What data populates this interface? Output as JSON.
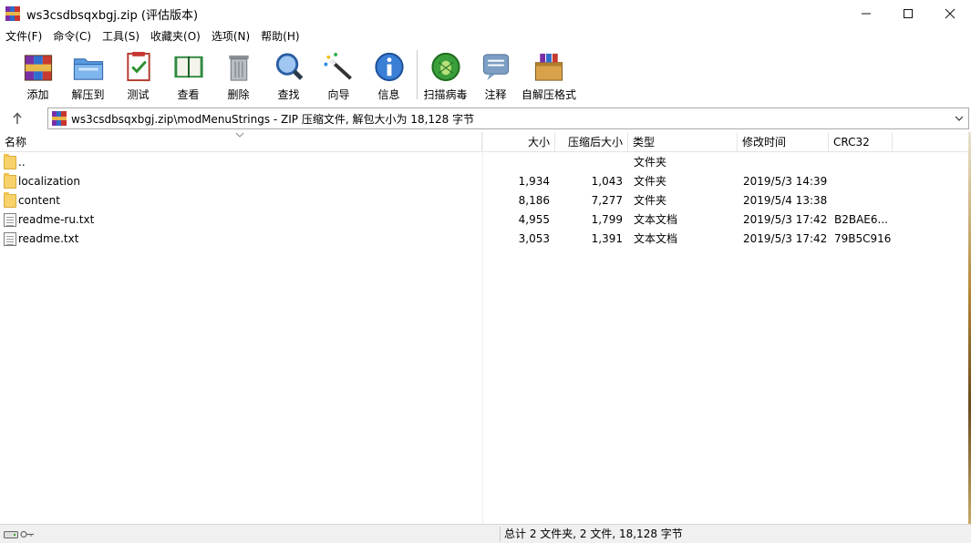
{
  "window": {
    "title": "ws3csdbsqxbgj.zip (评估版本)",
    "controls": [
      "minimize-icon",
      "maximize-icon",
      "close-icon"
    ]
  },
  "menu": [
    {
      "label": "文件(F)"
    },
    {
      "label": "命令(C)"
    },
    {
      "label": "工具(S)"
    },
    {
      "label": "收藏夹(O)"
    },
    {
      "label": "选项(N)"
    },
    {
      "label": "帮助(H)"
    }
  ],
  "toolbar": [
    {
      "label": "添加",
      "icon": "add-archive-icon"
    },
    {
      "label": "解压到",
      "icon": "extract-to-icon"
    },
    {
      "label": "测试",
      "icon": "test-icon"
    },
    {
      "label": "查看",
      "icon": "view-icon"
    },
    {
      "label": "删除",
      "icon": "delete-icon"
    },
    {
      "label": "查找",
      "icon": "find-icon"
    },
    {
      "label": "向导",
      "icon": "wizard-icon"
    },
    {
      "label": "信息",
      "icon": "info-icon"
    },
    {
      "label": "扫描病毒",
      "icon": "virus-scan-icon"
    },
    {
      "label": "注释",
      "icon": "comment-icon"
    },
    {
      "label": "自解压格式",
      "icon": "sfx-icon"
    }
  ],
  "address": {
    "path": "ws3csdbsqxbgj.zip\\modMenuStrings - ZIP 压缩文件, 解包大小为 18,128 字节"
  },
  "columns": {
    "name": "名称",
    "size": "大小",
    "packed": "压缩后大小",
    "type": "类型",
    "modified": "修改时间",
    "crc": "CRC32"
  },
  "files": [
    {
      "name": "..",
      "size": "",
      "packed": "",
      "type": "文件夹",
      "modified": "",
      "crc": "",
      "kind": "folder"
    },
    {
      "name": "localization",
      "size": "1,934",
      "packed": "1,043",
      "type": "文件夹",
      "modified": "2019/5/3 14:39",
      "crc": "",
      "kind": "folder"
    },
    {
      "name": "content",
      "size": "8,186",
      "packed": "7,277",
      "type": "文件夹",
      "modified": "2019/5/4 13:38",
      "crc": "",
      "kind": "folder"
    },
    {
      "name": "readme-ru.txt",
      "size": "4,955",
      "packed": "1,799",
      "type": "文本文档",
      "modified": "2019/5/3 17:42",
      "crc": "B2BAE6...",
      "kind": "text"
    },
    {
      "name": "readme.txt",
      "size": "3,053",
      "packed": "1,391",
      "type": "文本文档",
      "modified": "2019/5/3 17:42",
      "crc": "79B5C916",
      "kind": "text"
    }
  ],
  "status": {
    "summary": "总计 2 文件夹, 2 文件, 18,128 字节"
  }
}
